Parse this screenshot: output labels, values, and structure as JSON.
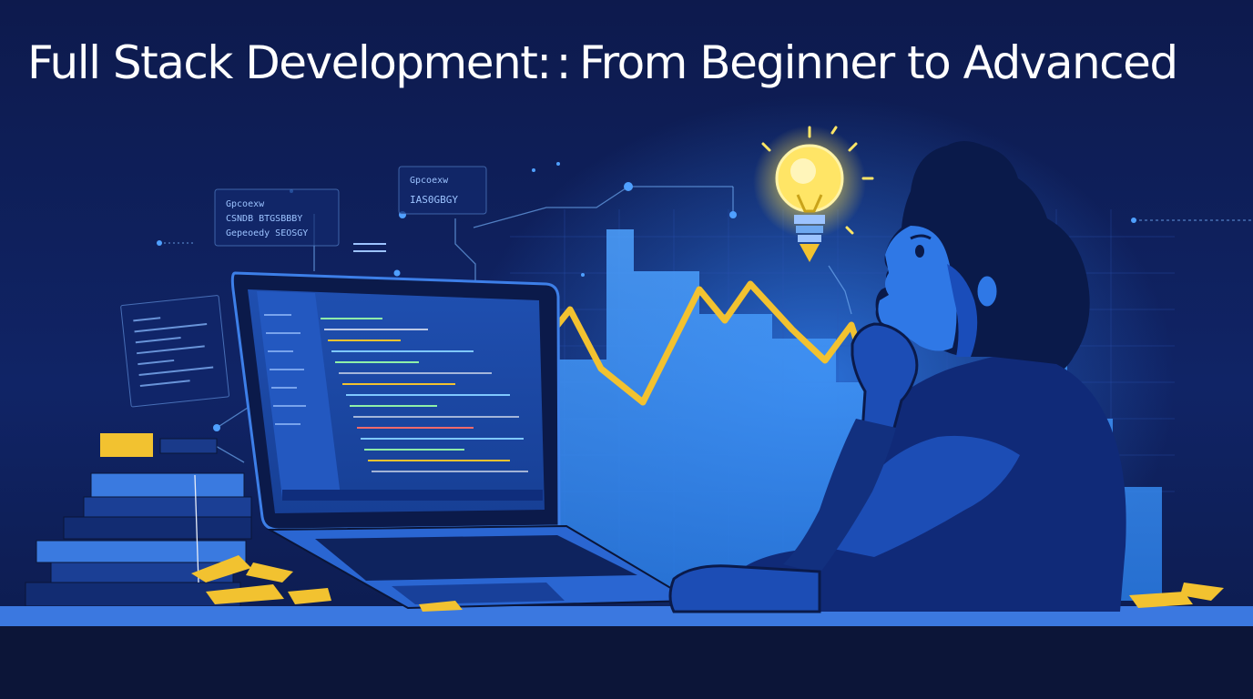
{
  "title": {
    "part1": "Full Stack Development:",
    "separator": ":",
    "part2": "From Beginner to Advanced"
  },
  "floating_labels": {
    "left_note_line1": "Gpcoexw",
    "left_note_line2": "CSNDB BTGSBBBY",
    "left_note_line3": "Gepeoedy  SEOSGY",
    "top_note_line1": "Gpcoexw",
    "top_note_line2": "IAS0GBGY"
  },
  "colors": {
    "background": "#0d1a4d",
    "accent_blue": "#3d8ff5",
    "accent_yellow": "#f2c230",
    "bulb_glow": "#ffe878"
  }
}
